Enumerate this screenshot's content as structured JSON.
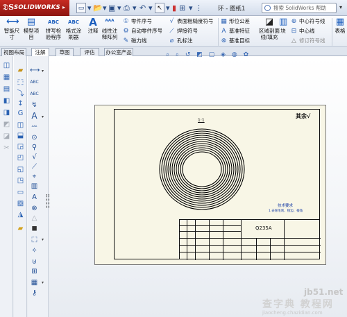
{
  "titlebar": {
    "logo": "SOLIDWORKS",
    "doc_title": "环 - 图纸1",
    "search_placeholder": "搜索 SolidWorks 帮助"
  },
  "ribbon": {
    "smart_dimension": "智能尺寸",
    "model_items": "模型项目",
    "spell_checker": "拼写检验程序",
    "format_painter": "格式涂刷器",
    "note": "注释",
    "linear_note_pattern": "线性注释阵列",
    "balloon": "零件序号",
    "auto_balloon": "自动零件序号",
    "magnetic_line": "磁力线",
    "surface_finish": "表面粗糙度符号",
    "weld_symbol": "焊接符号",
    "hole_callout": "孔标注",
    "gtol": "形位公差",
    "datum_feature": "基准特征",
    "datum_target": "基准目标",
    "area_hatch": "区域剖面线/填充",
    "block": "块",
    "centerline_symbol": "中心符号线",
    "centerline": "中心线",
    "revision_symbol": "修订符号线",
    "table": "表格"
  },
  "tabs": [
    "视图布局",
    "注解",
    "草图",
    "评估",
    "办公室产品"
  ],
  "active_tab": 1,
  "drawing": {
    "view_label": "1:1",
    "roughness_note": "其余",
    "material": "Q235A",
    "tech_title": "技术要求",
    "tech_text": "1.去除毛刺、锐边、棱角"
  },
  "watermark": {
    "site": "jb51.net",
    "brand": "查字典 教程网",
    "url": "jiaocheng.chazidian.com"
  },
  "colors": {
    "logo_red": "#c62b22",
    "accent_blue": "#2d63b5",
    "sheet_bg": "#f8f6e6"
  }
}
